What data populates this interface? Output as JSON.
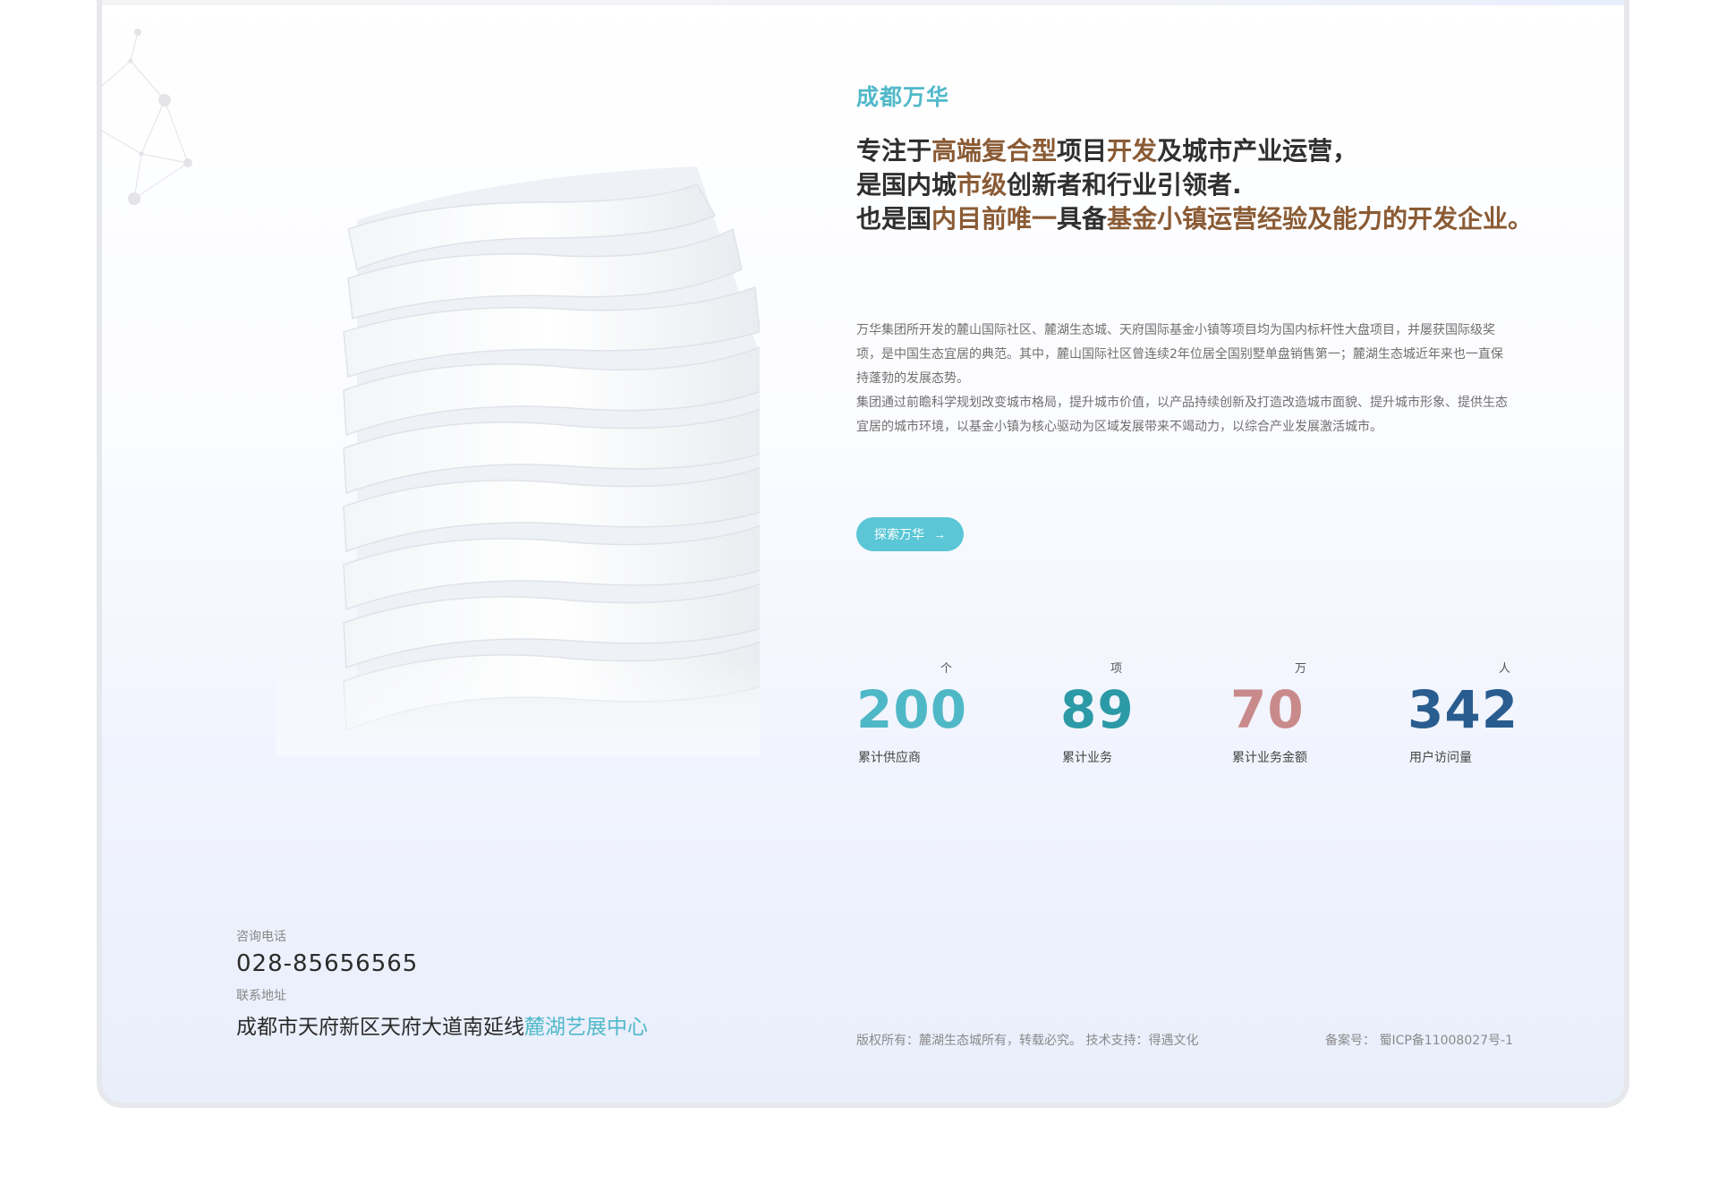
{
  "intro": {
    "eyebrow": "成都万华",
    "headline": {
      "line1_a": "专注于",
      "line1_b": "高端复合型",
      "line1_c": "项目",
      "line1_d": "开发",
      "line1_e": "及城市产业运营，",
      "line2_a": "是国内城",
      "line2_b": "市级",
      "line2_c": "创新者和行业引领者.",
      "line3_a": "也是国",
      "line3_b": "内目前唯一",
      "line3_c": "具备",
      "line3_d": "基金小镇运营经验及能力的开发企业。"
    },
    "paragraph1": "万华集团所开发的麓山国际社区、麓湖生态城、天府国际基金小镇等项目均为国内标杆性大盘项目，并屡获国际级奖项，是中国生态宜居的典范。其中，麓山国际社区曾连续2年位居全国别墅单盘销售第一；麓湖生态城近年来也一直保持蓬勃的发展态势。",
    "paragraph2": "集团通过前瞻科学规划改变城市格局，提升城市价值，以产品持续创新及打造改造城市面貌、提升城市形象、提供生态宜居的城市环境，以基金小镇为核心驱动为区域发展带来不竭动力，以综合产业发展激活城市。",
    "cta_label": "探索万华",
    "cta_arrow": "→"
  },
  "stats": [
    {
      "value": "200",
      "unit": "个",
      "label": "累计供应商",
      "color": "#4fb8c6"
    },
    {
      "value": "89",
      "unit": "项",
      "label": "累计业务",
      "color": "#2b9aa6"
    },
    {
      "value": "70",
      "unit": "万",
      "label": "累计业务金额",
      "color": "#c98a8c"
    },
    {
      "value": "342",
      "unit": "人",
      "label": "用户访问量",
      "color": "#2a5d8f"
    }
  ],
  "footer": {
    "phone_label": "咨询电话",
    "phone": "028-85656565",
    "address_label": "联系地址",
    "address_main": "成都市天府新区天府大道南延线",
    "address_accent": "麓湖艺展中心",
    "copyright": "版权所有：麓湖生态城所有，转载必究。  技术支持：得遇文化",
    "icp": "备案号：  蜀ICP备11008027号-1"
  },
  "colors": {
    "accent": "#51b9c9",
    "highlight": "#8a5b34",
    "button": "#5ac6d6"
  }
}
